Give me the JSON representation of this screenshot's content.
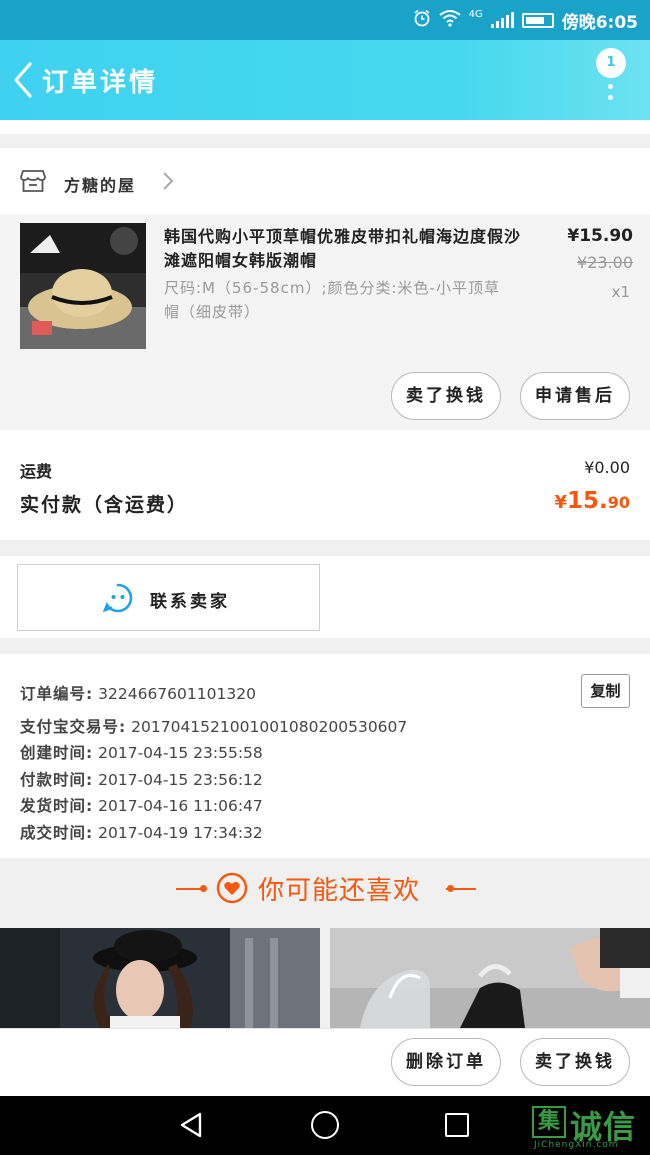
{
  "status_bar": {
    "carrier": "4G",
    "time": "傍晚6:05"
  },
  "header": {
    "title": "订单详情",
    "badge_count": "1"
  },
  "shop": {
    "name": "方糖的屋"
  },
  "product": {
    "title": "韩国代购小平顶草帽优雅皮带扣礼帽海边度假沙滩遮阳帽女韩版潮帽",
    "spec": "尺码:M（56-58cm）;颜色分类:米色-小平顶草帽（细皮带）",
    "price": "¥15.90",
    "original_price": "¥23.00",
    "quantity": "x1",
    "actions": [
      "卖了换钱",
      "申请售后"
    ]
  },
  "totals": {
    "shipping_label": "运费",
    "shipping_value": "¥0.00",
    "paid_label": "实付款（含运费）",
    "paid_currency": "¥",
    "paid_integer": "15.",
    "paid_decimal": "90"
  },
  "contact": {
    "label": "联系卖家"
  },
  "order_info": {
    "copy_label": "复制",
    "lines": [
      {
        "key": "订单编号:",
        "value": "3224667601101320"
      },
      {
        "key": "支付宝交易号:",
        "value": "2017041521001001080200530607"
      },
      {
        "key": "创建时间:",
        "value": "2017-04-15 23:55:58"
      },
      {
        "key": "付款时间:",
        "value": "2017-04-15 23:56:12"
      },
      {
        "key": "发货时间:",
        "value": "2017-04-16 11:06:47"
      },
      {
        "key": "成交时间:",
        "value": "2017-04-19 17:34:32"
      }
    ]
  },
  "recommend": {
    "title": "你可能还喜欢"
  },
  "bottom_bar": {
    "delete_label": "删除订单",
    "resell_label": "卖了换钱"
  },
  "watermark": {
    "brand": "诚信",
    "logo_char": "集",
    "url": "JiChengXin.com"
  },
  "colors": {
    "accent": "#45d8ee",
    "price_orange": "#f5580e",
    "watermark_green": "#3a9a45"
  }
}
